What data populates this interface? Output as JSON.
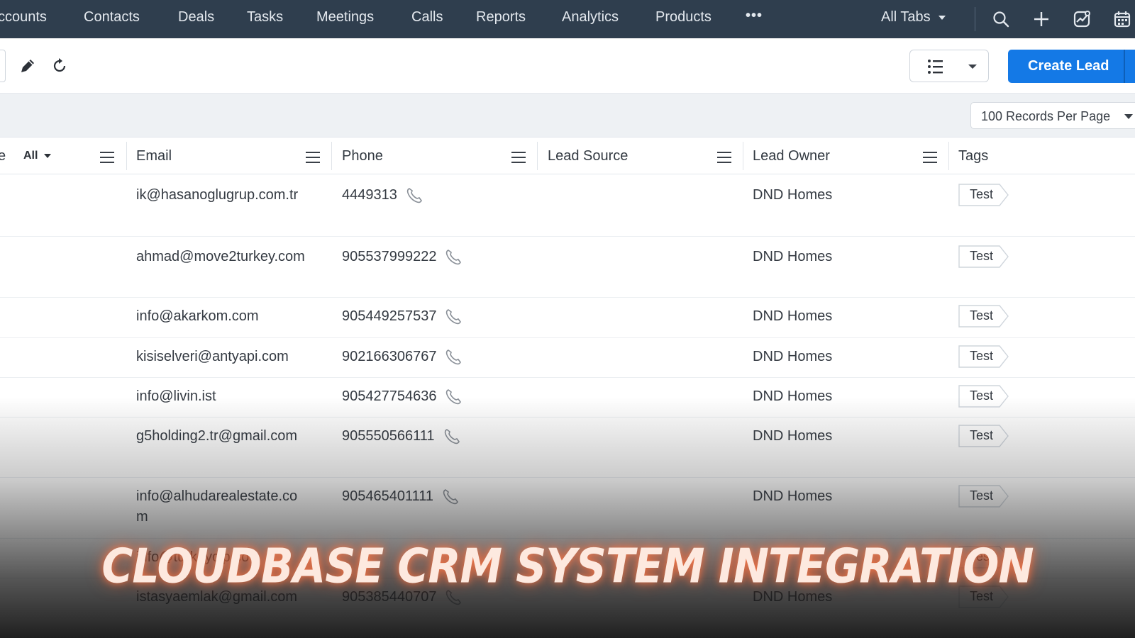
{
  "nav": {
    "items": [
      "ccounts",
      "Contacts",
      "Deals",
      "Tasks",
      "Meetings",
      "Calls",
      "Reports",
      "Analytics",
      "Products"
    ],
    "more_label": "•••",
    "all_tabs_label": "All Tabs",
    "icons": [
      "search-icon",
      "plus-icon",
      "activity-icon",
      "calendar-icon"
    ]
  },
  "toolbar": {
    "create_label": "Create Lead",
    "icons": [
      "edit-icon",
      "refresh-icon",
      "list-view-icon",
      "chevron-down-icon"
    ]
  },
  "records_per_page": "100 Records Per Page",
  "table": {
    "filter_partial_label": "e",
    "filter_value": "All",
    "columns": [
      "Email",
      "Phone",
      "Lead Source",
      "Lead Owner",
      "Tags"
    ],
    "rows": [
      {
        "email": "ik@hasanoglugrup.com.tr",
        "phone": "4449313",
        "lead_source": "",
        "owner": "DND Homes",
        "tag": "Test"
      },
      {
        "email": "ahmad@move2turkey.com",
        "phone": "905537999222",
        "lead_source": "",
        "owner": "DND Homes",
        "tag": "Test"
      },
      {
        "email": "info@akarkom.com",
        "phone": "905449257537",
        "lead_source": "",
        "owner": "DND Homes",
        "tag": "Test"
      },
      {
        "email": "kisiselveri@antyapi.com",
        "phone": "902166306767",
        "lead_source": "",
        "owner": "DND Homes",
        "tag": "Test"
      },
      {
        "email": "info@livin.ist",
        "phone": "905427754636",
        "lead_source": "",
        "owner": "DND Homes",
        "tag": "Test"
      },
      {
        "email": "g5holding2.tr@gmail.com",
        "phone": "905550566111",
        "lead_source": "",
        "owner": "DND Homes",
        "tag": "Test"
      },
      {
        "email": "info@alhudarealestate.com",
        "phone": "905465401111",
        "lead_source": "",
        "owner": "DND Homes",
        "tag": "Test"
      },
      {
        "email": "info@turkeyclp.co",
        "phone": "",
        "lead_source": "",
        "owner": "",
        "tag": "Test"
      },
      {
        "email": "istasyaemlak@gmail.com",
        "phone": "905385440707",
        "lead_source": "",
        "owner": "DND Homes",
        "tag": "Test"
      }
    ]
  },
  "caption": "CLOUDBASE CRM SYSTEM INTEGRATION",
  "colors": {
    "nav_bg": "#2f3e4e",
    "accent": "#1479e6"
  }
}
